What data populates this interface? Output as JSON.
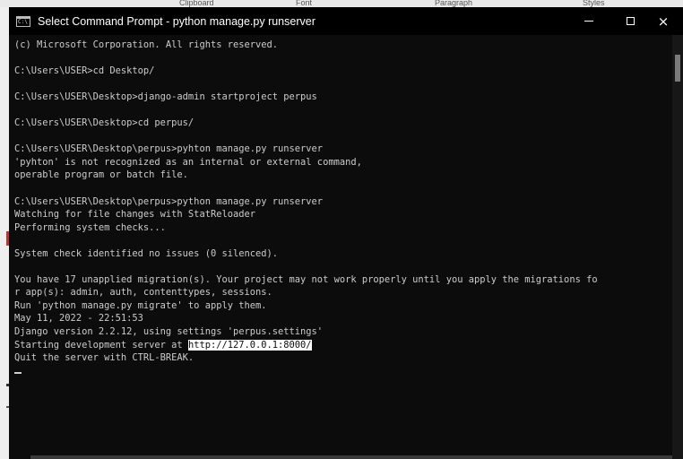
{
  "background": {
    "tabs": [
      "Clipboard",
      "Font",
      "Paragraph",
      "Styles"
    ]
  },
  "window": {
    "title": "Select Command Prompt - python  manage.py runserver",
    "icon": "cmd-icon",
    "controls": {
      "minimize": "minimize-icon",
      "maximize": "maximize-icon",
      "close": "×"
    }
  },
  "console": {
    "lines": [
      "(c) Microsoft Corporation. All rights reserved.",
      "",
      "C:\\Users\\USER>cd Desktop/",
      "",
      "C:\\Users\\USER\\Desktop>django-admin startproject perpus",
      "",
      "C:\\Users\\USER\\Desktop>cd perpus/",
      "",
      "C:\\Users\\USER\\Desktop\\perpus>pyhton manage.py runserver",
      "'pyhton' is not recognized as an internal or external command,",
      "operable program or batch file.",
      "",
      "C:\\Users\\USER\\Desktop\\perpus>python manage.py runserver",
      "Watching for file changes with StatReloader",
      "Performing system checks...",
      "",
      "System check identified no issues (0 silenced).",
      "",
      "You have 17 unapplied migration(s). Your project may not work properly until you apply the migrations fo",
      "r app(s): admin, auth, contenttypes, sessions.",
      "Run 'python manage.py migrate' to apply them.",
      "May 11, 2022 - 22:51:53",
      "Django version 2.2.12, using settings 'perpus.settings'"
    ],
    "server_prefix": "Starting development server at ",
    "server_url": "http://127.0.0.1:8000/",
    "quit_line": "Quit the server with CTRL-BREAK."
  },
  "colors": {
    "console_bg": "#0c0c0c",
    "console_text": "#cccccc",
    "selection_bg": "#ffffff"
  }
}
